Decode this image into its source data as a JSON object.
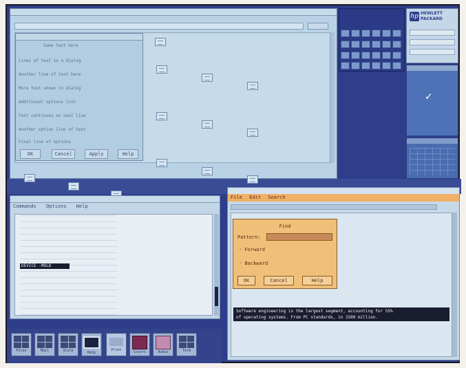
{
  "hp_logo": {
    "text": "HEWLETT PACKARD",
    "symbol": "hp"
  },
  "file_manager": {
    "dialog_lines": [
      "Some text here",
      "Lines of text in a dialog",
      "Another line of text here",
      "More text shown in dialog",
      "Additional options list",
      "Text continues on next line",
      "Another option line of text",
      "Final line of options"
    ],
    "dialog_buttons": [
      "OK",
      "Cancel",
      "Apply",
      "Help"
    ]
  },
  "terminal": {
    "menu": [
      "Commands",
      "Options",
      "Help"
    ],
    "highlight": "DEVICE -MOLD"
  },
  "editor": {
    "menu": [
      "File",
      "Edit",
      "Search"
    ],
    "find_dialog": {
      "title": "Find",
      "label": "Pattern:",
      "value": "",
      "options": [
        "Forward",
        "Backward"
      ],
      "buttons": [
        "OK",
        "Cancel",
        "Help"
      ]
    },
    "highlighted_text": [
      "Software engineering is the largest segment, accounting for 55%",
      "of operating systems. From PC standards, in 1500 million."
    ]
  },
  "dock": [
    "Files",
    "Mail",
    "Style",
    "Help",
    "Print",
    "Colors",
    "Audio",
    "Term"
  ],
  "colors": {
    "desktop": "#2e3e8a",
    "window": "#b9d2e6",
    "dialog": "#f0c07a",
    "highlight": "#1a1c30",
    "maroon_icon": "#7d2a52"
  }
}
